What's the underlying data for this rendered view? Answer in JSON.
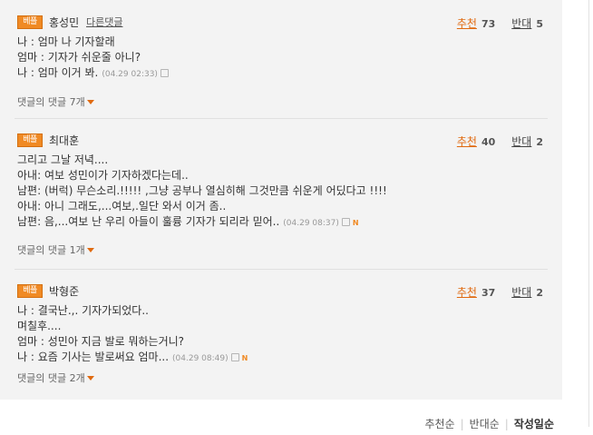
{
  "comments": [
    {
      "badge": "베플",
      "author": "홍성민",
      "reply_link": "다른댓글",
      "recommend_label": "추천",
      "recommend_count": "73",
      "oppose_label": "반대",
      "oppose_count": "5",
      "lines": [
        "나 : 엄마 나 기자할래",
        "엄마 : 기자가 쉬운줄 아니?",
        "나 : 엄마 이거 봐."
      ],
      "timestamp": "(04.29 02:33)",
      "has_new": false,
      "replies_label": "댓글의 댓글 7개"
    },
    {
      "badge": "베플",
      "author": "최대훈",
      "reply_link": "",
      "recommend_label": "추천",
      "recommend_count": "40",
      "oppose_label": "반대",
      "oppose_count": "2",
      "lines": [
        "그리고 그날 저녁....",
        "아내: 여보 성민이가 기자하겠다는데..",
        "남편: (버럭) 무슨소리.!!!!! ,그냥 공부나 열심히해 그것만큼 쉬운게 어딨다고 !!!!",
        "아내: 아니 그래도,...여보,.일단 와서 이거 좀..",
        "남편: 음,...여보 난 우리 아들이 훌륭 기자가 되리라 믿어.."
      ],
      "timestamp": "(04.29 08:37)",
      "has_new": true,
      "replies_label": "댓글의 댓글 1개"
    },
    {
      "badge": "베플",
      "author": "박형준",
      "reply_link": "",
      "recommend_label": "추천",
      "recommend_count": "37",
      "oppose_label": "반대",
      "oppose_count": "2",
      "lines": [
        "나 : 결국난.,. 기자가되었다..",
        "며칠후....",
        "엄마 : 성민아 지금 발로 뭐하는거니?",
        "나 : 요즘 기사는 발로써요 엄마..."
      ],
      "timestamp": "(04.29 08:49)",
      "has_new": true,
      "replies_label": "댓글의 댓글 2개"
    }
  ],
  "new_badge": "N",
  "sort": {
    "recommend": "추천순",
    "oppose": "반대순",
    "latest": "작성일순"
  },
  "colors": {
    "accent": "#f08a24",
    "panel": "#f3f3f3"
  }
}
